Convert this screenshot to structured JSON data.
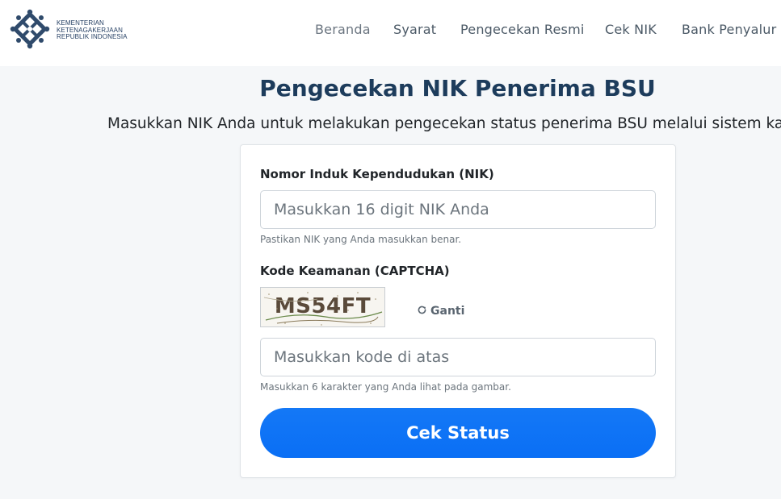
{
  "brand": {
    "line1": "KEMENTERIAN",
    "line2": "KETENAGAKERJAAN",
    "line3": "REPUBLIK INDONESIA",
    "color": "#2f4a6b"
  },
  "nav": {
    "items": [
      {
        "label": "Beranda"
      },
      {
        "label": "Syarat"
      },
      {
        "label": "Pengecekan Resmi"
      },
      {
        "label": "Cek NIK"
      },
      {
        "label": "Bank Penyalur"
      }
    ]
  },
  "page": {
    "title": "Pengecekan NIK Penerima BSU",
    "subtitle": "Masukkan NIK Anda untuk melakukan pengecekan status penerima BSU melalui sistem ka"
  },
  "form": {
    "nik_label": "Nomor Induk Kependudukan (NIK)",
    "nik_placeholder": "Masukkan 16 digit NIK Anda",
    "nik_help": "Pastikan NIK yang Anda masukkan benar.",
    "captcha_label": "Kode Keamanan (CAPTCHA)",
    "captcha_code": "MS54FT",
    "refresh_label": "Ganti",
    "captcha_placeholder": "Masukkan kode di atas",
    "captcha_help": "Masukkan 6 karakter yang Anda lihat pada gambar.",
    "submit_label": "Cek Status"
  },
  "colors": {
    "primary_button": "#0d6efd",
    "title": "#1d3c5c",
    "nav_text": "#4b5966"
  }
}
